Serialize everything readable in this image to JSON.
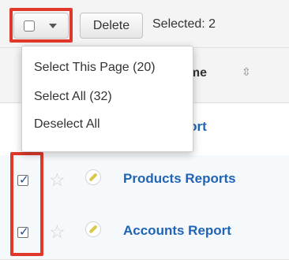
{
  "toolbar": {
    "delete_label": "Delete",
    "selected_label": "Selected: 2"
  },
  "table": {
    "name_column": "ame",
    "rows": [
      {
        "name": "ounts Report",
        "checked": false
      },
      {
        "name": "Products Reports",
        "checked": true
      },
      {
        "name": "Accounts Report",
        "checked": true
      }
    ]
  },
  "dropdown": {
    "items": [
      "Select This Page (20)",
      "Select All (32)",
      "Deselect All"
    ]
  },
  "colors": {
    "highlight": "#e0392b",
    "link": "#1f64b5"
  },
  "icons": {
    "sort": "sort-icon",
    "favorite": "star-icon",
    "edit": "pencil-icon"
  }
}
